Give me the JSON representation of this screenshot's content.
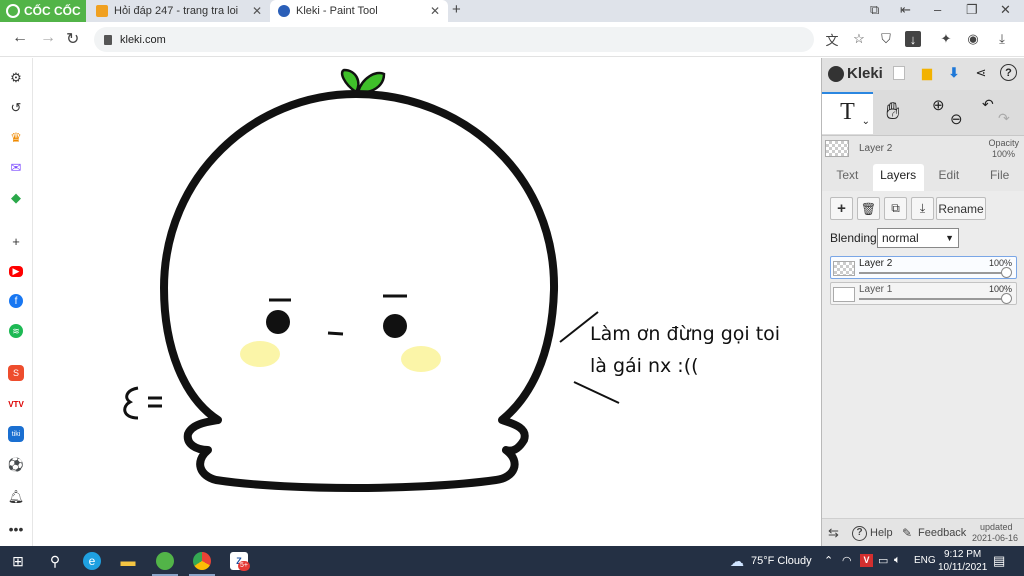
{
  "browser": {
    "brand": "CỐC CỐC",
    "tabs": [
      {
        "title": "Hỏi đáp 247 - trang tra loi",
        "active": false
      },
      {
        "title": "Kleki - Paint Tool",
        "active": true
      }
    ],
    "url": "kleki.com"
  },
  "drawing": {
    "line1": "Làm ơn đừng gọi toi",
    "line2": "là gái nx :(("
  },
  "kleki": {
    "logo": "Kleki",
    "tool_text_glyph": "T",
    "current_layer": "Layer 2",
    "opacity_label": "Opacity",
    "opacity_value": "100%",
    "tabs": [
      "Text",
      "Layers",
      "Edit",
      "File"
    ],
    "active_tab": "Layers",
    "rename_label": "Rename",
    "blending_label": "Blending",
    "blending_value": "normal",
    "layers": [
      {
        "name": "Layer 2",
        "opacity": "100%",
        "selected": true
      },
      {
        "name": "Layer 1",
        "opacity": "100%",
        "selected": false
      }
    ],
    "footer": {
      "help": "Help",
      "feedback": "Feedback",
      "updated_label": "updated",
      "updated_date": "2021-06-16"
    }
  },
  "taskbar": {
    "weather": "75°F  Cloudy",
    "lang": "ENG",
    "time": "9:12 PM",
    "date": "10/11/2021",
    "badge": "5+"
  },
  "colors": {
    "brand_green": "#52b448",
    "taskbar": "#243044",
    "accent_blue": "#2a86e0",
    "sprout_green": "#3fbf2a",
    "blush_yellow": "#fbf5a8"
  }
}
